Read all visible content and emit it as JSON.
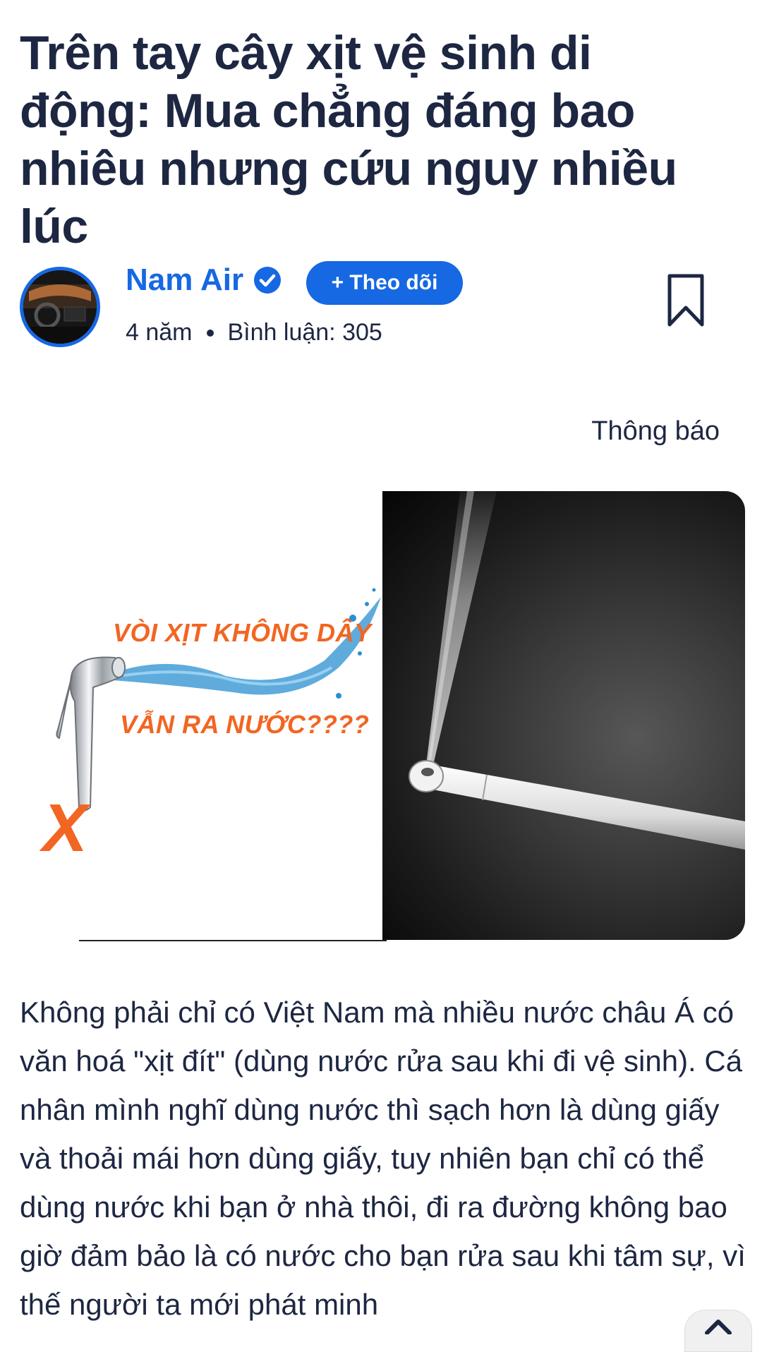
{
  "article": {
    "title": "Trên tay cây xịt vệ sinh di động: Mua chẳng đáng bao nhiêu nhưng cứu nguy nhiều lúc",
    "author": {
      "name": "Nam Air",
      "verified_icon": "verified-check-icon",
      "follow_label": "+ Theo dõi",
      "age": "4 năm",
      "comments": "Bình luận: 305"
    },
    "notify_label": "Thông báo",
    "hero_image": {
      "promo_line1": "VÒI XỊT KHÔNG DÂY",
      "promo_line2": "VẪN RA NƯỚC????",
      "mark": "X"
    },
    "body": "Không phải chỉ có Việt Nam mà nhiều nước châu Á có văn hoá \"xịt đít\" (dùng nước rửa sau khi đi vệ sinh). Cá nhân mình nghĩ dùng nước thì sạch hơn là dùng giấy và thoải mái hơn dùng giấy, tuy nhiên bạn chỉ có thể dùng nước khi bạn ở nhà thôi, đi ra đường không bao giờ đảm bảo là có nước cho bạn rửa sau khi tâm sự, vì thế người ta mới phát minh"
  },
  "colors": {
    "accent": "#1668e3",
    "text": "#1d2742",
    "promo": "#f26522"
  }
}
